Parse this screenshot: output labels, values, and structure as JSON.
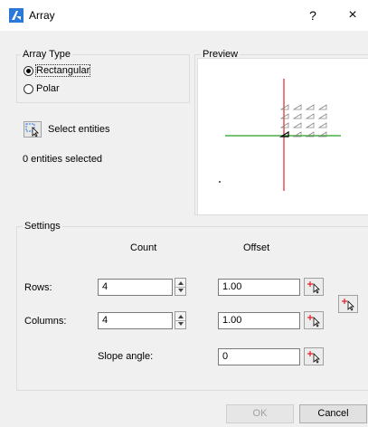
{
  "window": {
    "title": "Array",
    "help": "?",
    "close": "×"
  },
  "array_type": {
    "label": "Array Type",
    "options": [
      {
        "label": "Rectangular",
        "checked": true
      },
      {
        "label": "Polar",
        "checked": false
      }
    ]
  },
  "select_entities": {
    "label": "Select entities",
    "status": "0 entities selected"
  },
  "preview": {
    "label": "Preview"
  },
  "settings": {
    "label": "Settings",
    "count_header": "Count",
    "offset_header": "Offset",
    "rows": {
      "label": "Rows:",
      "count": "4",
      "offset": "1.00"
    },
    "columns": {
      "label": "Columns:",
      "count": "4",
      "offset": "1.00"
    },
    "slope": {
      "label": "Slope angle:",
      "value": "0"
    }
  },
  "buttons": {
    "ok": "OK",
    "cancel": "Cancel"
  },
  "colors": {
    "accent": "#2a79d8",
    "axis_red": "#e0202a",
    "axis_green": "#21a021"
  }
}
